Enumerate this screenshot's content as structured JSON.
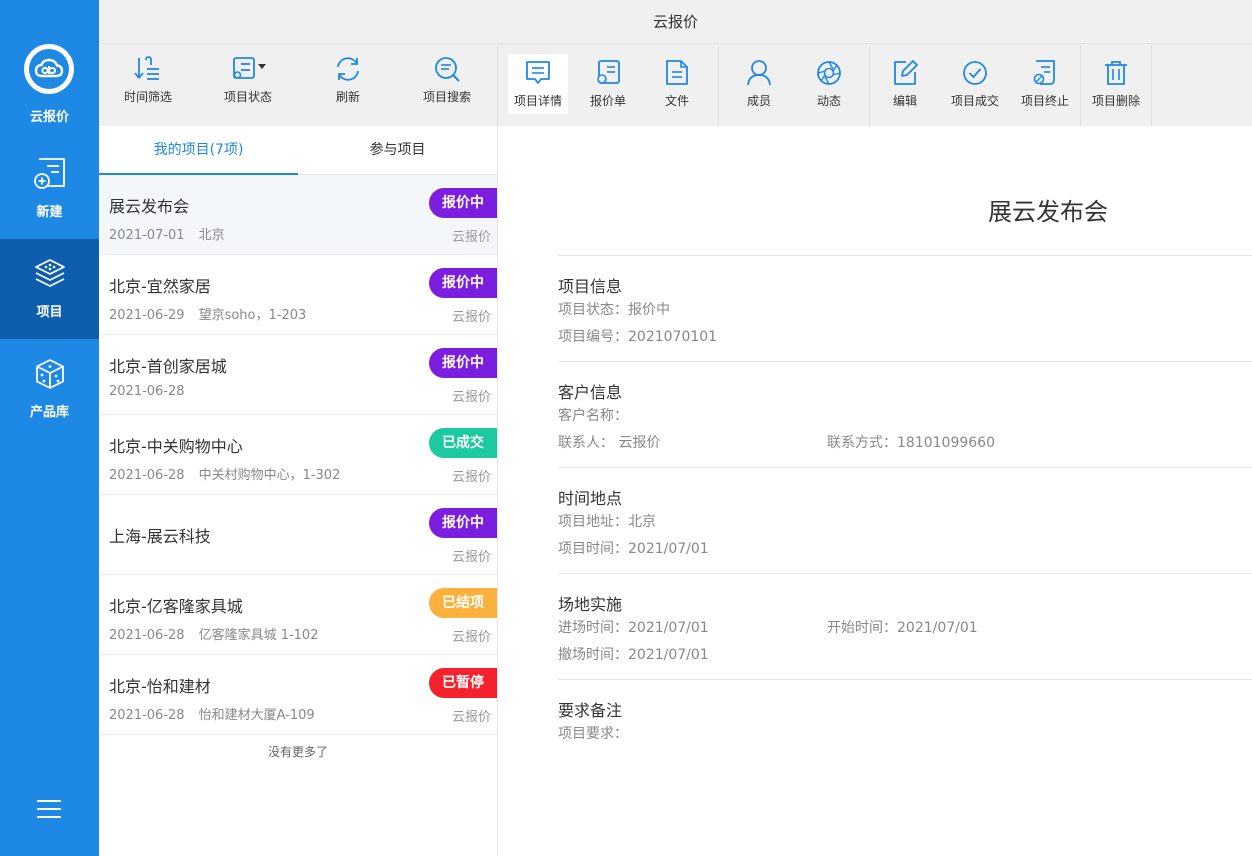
{
  "app": {
    "title": "云报价"
  },
  "nav": {
    "logo_label": "云报价",
    "items": [
      {
        "label": "新建"
      },
      {
        "label": "项目"
      },
      {
        "label": "产品库"
      }
    ]
  },
  "toolbar": {
    "time_filter": "时间筛选",
    "project_status": "项目状态",
    "refresh": "刷新",
    "project_search": "项目搜索",
    "project_detail": "项目详情",
    "quote_sheet": "报价单",
    "files": "文件",
    "members": "成员",
    "activity": "动态",
    "edit": "编辑",
    "project_deal": "项目成交",
    "project_terminate": "项目终止",
    "project_delete": "项目删除"
  },
  "list": {
    "tabs": [
      {
        "label": "我的项目(7项)"
      },
      {
        "label": "参与项目"
      }
    ],
    "items": [
      {
        "name": "展云发布会",
        "date": "2021-07-01",
        "location": "北京",
        "status": "报价中",
        "status_color": "#7c1ee0",
        "source": "云报价"
      },
      {
        "name": "北京-宜然家居",
        "date": "2021-06-29",
        "location": "望京soho，1-203",
        "status": "报价中",
        "status_color": "#7c1ee0",
        "source": "云报价"
      },
      {
        "name": "北京-首创家居城",
        "date": "2021-06-28",
        "location": "",
        "status": "报价中",
        "status_color": "#7c1ee0",
        "source": "云报价"
      },
      {
        "name": "北京-中关购物中心",
        "date": "2021-06-28",
        "location": "中关村购物中心，1-302",
        "status": "已成交",
        "status_color": "#1cc9a0",
        "source": "云报价"
      },
      {
        "name": "上海-展云科技",
        "date": "",
        "location": "",
        "status": "报价中",
        "status_color": "#7c1ee0",
        "source": "云报价"
      },
      {
        "name": "北京-亿客隆家具城",
        "date": "2021-06-28",
        "location": "亿客隆家具城 1-102",
        "status": "已结项",
        "status_color": "#fbb13c",
        "source": "云报价"
      },
      {
        "name": "北京-怡和建材",
        "date": "2021-06-28",
        "location": "怡和建材大厦A-109",
        "status": "已暂停",
        "status_color": "#f5222d",
        "source": "云报价"
      }
    ],
    "no_more": "没有更多了"
  },
  "detail": {
    "title": "展云发布会",
    "project_info": {
      "heading": "项目信息",
      "status": "项目状态：报价中",
      "number": "项目编号：2021070101"
    },
    "customer_info": {
      "heading": "客户信息",
      "customer_name": "客户名称：",
      "contact": "联系人：   云报价",
      "phone": "联系方式：18101099660"
    },
    "time_place": {
      "heading": "时间地点",
      "address": "项目地址：北京",
      "time": "项目时间：2021/07/01"
    },
    "site": {
      "heading": "场地实施",
      "enter_time": "进场时间：2021/07/01",
      "start_time": "开始时间：2021/07/01",
      "exit_time": "撤场时间：2021/07/01"
    },
    "remarks": {
      "heading": "要求备注",
      "requirements": "项目要求："
    }
  }
}
